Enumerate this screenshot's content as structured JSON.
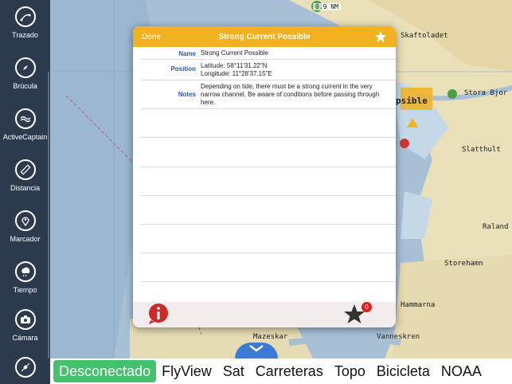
{
  "sidebar": {
    "items": [
      {
        "label": "Trazado",
        "icon": "route-icon"
      },
      {
        "label": "Brúcula",
        "icon": "compass-icon"
      },
      {
        "label": "ActiveCaptain",
        "icon": "activecaptain-icon"
      },
      {
        "label": "Distancia",
        "icon": "ruler-icon"
      },
      {
        "label": "Marcador",
        "icon": "map-pin-icon"
      },
      {
        "label": "Tiempo",
        "icon": "weather-icon"
      },
      {
        "label": "Cámara",
        "icon": "camera-icon"
      },
      {
        "label": "",
        "icon": "satellite-icon"
      }
    ]
  },
  "dialog": {
    "done_label": "Done",
    "title": "Strong Current Possible",
    "rows": [
      {
        "label": "Name",
        "value": "Strong Current Possible"
      },
      {
        "label": "Position",
        "value_lines": [
          "Latitude: 58°11'31.22\"N",
          "Longitude: 11°28'37.15\"E"
        ]
      },
      {
        "label": "Notes",
        "value": "Depending on tide, there must be a strong current in the very narrow channel.  Be aware of conditions before passing through here."
      }
    ],
    "favorites_count": "0"
  },
  "map": {
    "labels": [
      "Skaftoladet",
      "Stora Bjor",
      "Slatthult",
      "Raland",
      "Storehamn",
      "Hammarna",
      "Mazeskar",
      "Vanneskren",
      "psible"
    ],
    "scale_text": "0.9 NM"
  },
  "layers": {
    "items": [
      "Desconectado",
      "FlyView",
      "Sat",
      "Carreteras",
      "Topo",
      "Bicicleta",
      "NOAA"
    ],
    "active": "Desconectado"
  },
  "colors": {
    "sidebar": "#2b3a4c",
    "header": "#f2b21f",
    "active_layer": "#43c16d",
    "label_blue": "#2b5aa8"
  }
}
